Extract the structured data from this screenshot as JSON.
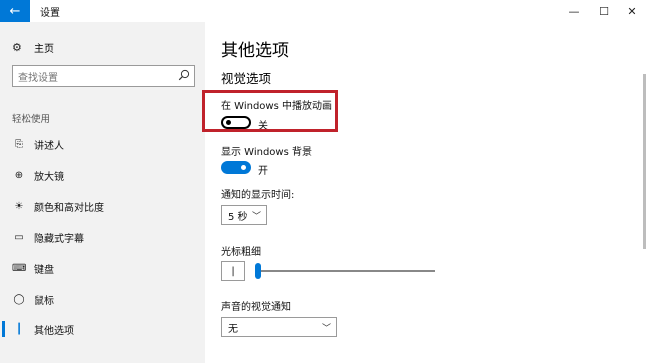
{
  "window": {
    "title": "设置",
    "back_glyph": "←",
    "minimize_glyph": "—",
    "maximize_glyph": "☐",
    "close_glyph": "✕"
  },
  "sidebar": {
    "home_label": "主页",
    "search_placeholder": "查找设置",
    "section_label": "轻松使用",
    "items": [
      {
        "label": "讲述人",
        "icon": "narrator-icon",
        "glyph": "⎘"
      },
      {
        "label": "放大镜",
        "icon": "magnifier-icon",
        "glyph": "⊕"
      },
      {
        "label": "颜色和高对比度",
        "icon": "contrast-icon",
        "glyph": "☀"
      },
      {
        "label": "隐藏式字幕",
        "icon": "captions-icon",
        "glyph": "▭"
      },
      {
        "label": "键盘",
        "icon": "keyboard-icon",
        "glyph": "⌨"
      },
      {
        "label": "鼠标",
        "icon": "mouse-icon",
        "glyph": "◯"
      },
      {
        "label": "其他选项",
        "icon": "other-options-icon",
        "glyph": "┃"
      }
    ]
  },
  "main": {
    "title": "其他选项",
    "section_title": "视觉选项",
    "animation": {
      "label": "在 Windows 中播放动画",
      "state": "关"
    },
    "background": {
      "label": "显示 Windows 背景",
      "state": "开"
    },
    "notification": {
      "label": "通知的显示时间:",
      "value": "5 秒"
    },
    "cursor": {
      "label": "光标粗细",
      "value": "|"
    },
    "audio_visual": {
      "label": "声音的视觉通知",
      "value": "无"
    }
  },
  "colors": {
    "accent": "#0078d7",
    "highlight_border": "#c0222b"
  }
}
